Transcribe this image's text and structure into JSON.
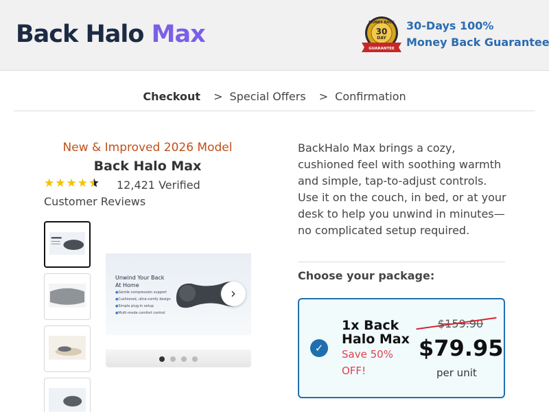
{
  "header": {
    "logo_text": "Back Halo",
    "logo_max": "Max",
    "badge": {
      "line1": "MONEY BACK",
      "days": "30",
      "day_label": "DAY",
      "ribbon": "GUARANTEE"
    },
    "guarantee_line1": "30-Days 100%",
    "guarantee_line2": "Money Back Guarantee"
  },
  "breadcrumb": {
    "steps": [
      "Checkout",
      "Special Offers",
      "Confirmation"
    ],
    "separator": ">"
  },
  "product": {
    "tagline": "New & Improved 2026 Model",
    "title": "Back Halo Max",
    "stars": "★★★★",
    "rating": 4.5,
    "reviews": "12,421 Verified Customer Reviews",
    "carousel_count": 4,
    "main_image": {
      "heading": "Unwind Your Back",
      "subheading": "At Home",
      "bullets": [
        "Gentle compression support",
        "Cushioned, ultra-comfy design",
        "Simple plug-in setup",
        "Multi-mode comfort control"
      ]
    },
    "next_glyph": "›"
  },
  "description": "BackHalo Max brings a cozy, cushioned feel with soothing warmth and simple, tap-to-adjust controls. Use it on the couch, in bed, or at your desk to help you unwind in minutes—no complicated setup required.",
  "packages": {
    "heading": "Choose your package:",
    "items": [
      {
        "name": "1x Back Halo Max",
        "save": "Save 50% OFF!",
        "old_price": "$159.90",
        "price": "$79.95",
        "unit": "per unit",
        "selected": true
      }
    ]
  },
  "colors": {
    "brand_navy": "#1d2a44",
    "brand_purple": "#7b5fe6",
    "accent_blue": "#1f6fae",
    "tagline_orange": "#c0501a",
    "save_red": "#e04050",
    "star_yellow": "#f2c200"
  }
}
